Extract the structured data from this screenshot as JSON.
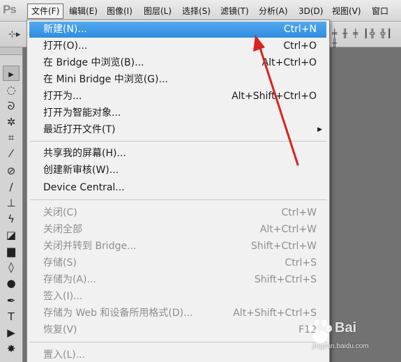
{
  "app": {
    "logo": "Ps"
  },
  "menubar": {
    "items": [
      {
        "label": "文件(F)",
        "active": true
      },
      {
        "label": "编辑(E)"
      },
      {
        "label": "图像(I)"
      },
      {
        "label": "图层(L)"
      },
      {
        "label": "选择(S)"
      },
      {
        "label": "滤镜(T)"
      },
      {
        "label": "分析(A)"
      },
      {
        "label": "3D(D)"
      },
      {
        "label": "视图(V)"
      },
      {
        "label": "窗口(W)"
      }
    ]
  },
  "file_menu": {
    "items": [
      {
        "label": "新建(N)...",
        "shortcut": "Ctrl+N",
        "highlighted": true
      },
      {
        "label": "打开(O)...",
        "shortcut": "Ctrl+O"
      },
      {
        "label": "在 Bridge 中浏览(B)...",
        "shortcut": "Alt+Ctrl+O"
      },
      {
        "label": "在 Mini Bridge 中浏览(G)...",
        "shortcut": ""
      },
      {
        "label": "打开为...",
        "shortcut": "Alt+Shift+Ctrl+O"
      },
      {
        "label": "打开为智能对象...",
        "shortcut": ""
      },
      {
        "label": "最近打开文件(T)",
        "shortcut": "",
        "submenu": true
      },
      {
        "label": "共享我的屏幕(H)...",
        "shortcut": ""
      },
      {
        "label": "创建新审核(W)...",
        "shortcut": ""
      },
      {
        "label": "Device Central...",
        "shortcut": ""
      },
      {
        "label": "关闭(C)",
        "shortcut": "Ctrl+W",
        "disabled": true
      },
      {
        "label": "关闭全部",
        "shortcut": "Alt+Ctrl+W",
        "disabled": true
      },
      {
        "label": "关闭并转到 Bridge...",
        "shortcut": "Shift+Ctrl+W",
        "disabled": true
      },
      {
        "label": "存储(S)",
        "shortcut": "Ctrl+S",
        "disabled": true
      },
      {
        "label": "存储为(A)...",
        "shortcut": "Shift+Ctrl+S",
        "disabled": true
      },
      {
        "label": "签入(I)...",
        "shortcut": "",
        "disabled": true
      },
      {
        "label": "存储为 Web 和设备所用格式(D)...",
        "shortcut": "Alt+Shift+Ctrl+S",
        "disabled": true
      },
      {
        "label": "恢复(V)",
        "shortcut": "F12",
        "disabled": true
      },
      {
        "label": "置入(L)...",
        "shortcut": "",
        "disabled": true
      }
    ]
  },
  "watermark": {
    "text": "Bai",
    "sub": "jingyan.baidu.com"
  },
  "colors": {
    "highlight": "#3b9ae8",
    "annotation_arrow": "#d9221f",
    "menu_bg": "#f1f1f1"
  },
  "icons": {
    "submenu_arrow": "triangle-right-icon",
    "pointer": "red-arrow-annotation"
  }
}
